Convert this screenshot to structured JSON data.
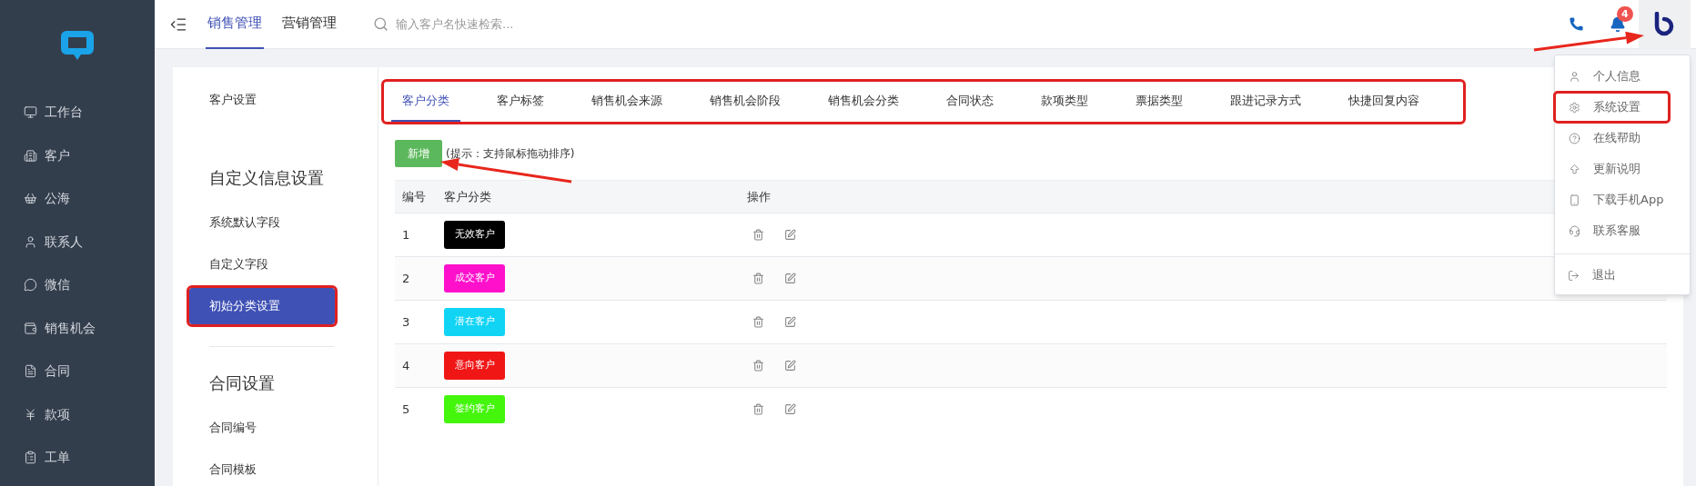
{
  "sidebar": {
    "items": [
      {
        "label": "工作台"
      },
      {
        "label": "客户"
      },
      {
        "label": "公海"
      },
      {
        "label": "联系人"
      },
      {
        "label": "微信"
      },
      {
        "label": "销售机会"
      },
      {
        "label": "合同"
      },
      {
        "label": "款项"
      },
      {
        "label": "工单"
      }
    ]
  },
  "top_nav": {
    "tabs": [
      {
        "label": "销售管理",
        "selected": true
      },
      {
        "label": "营销管理",
        "selected": false
      }
    ],
    "search": {
      "placeholder": "输入客户名快速检索..."
    },
    "notifications": {
      "badge": "4"
    }
  },
  "settings_nav": {
    "groups": [
      {
        "items": [
          {
            "label": "客户设置",
            "selected": false,
            "highlighted": false
          }
        ]
      },
      {
        "divider_above": false,
        "heading": "自定义信息设置",
        "items": [
          {
            "label": "系统默认字段",
            "selected": false,
            "highlighted": false
          },
          {
            "label": "自定义字段",
            "selected": false,
            "highlighted": false
          },
          {
            "label": "初始分类设置",
            "selected": true,
            "highlighted": true
          }
        ]
      },
      {
        "divider_above": true,
        "heading": "合同设置",
        "items": [
          {
            "label": "合同编号",
            "selected": false,
            "highlighted": false
          },
          {
            "label": "合同模板",
            "selected": false,
            "highlighted": false
          }
        ]
      }
    ]
  },
  "tabs": {
    "highlighted": true,
    "items": [
      {
        "label": "客户分类",
        "selected": true
      },
      {
        "label": "客户标签",
        "selected": false
      },
      {
        "label": "销售机会来源",
        "selected": false
      },
      {
        "label": "销售机会阶段",
        "selected": false
      },
      {
        "label": "销售机会分类",
        "selected": false
      },
      {
        "label": "合同状态",
        "selected": false
      },
      {
        "label": "款项类型",
        "selected": false
      },
      {
        "label": "票据类型",
        "selected": false
      },
      {
        "label": "跟进记录方式",
        "selected": false
      },
      {
        "label": "快捷回复内容",
        "selected": false
      }
    ]
  },
  "toolbar": {
    "add_button": "新增",
    "hint": "(提示：支持鼠标拖动排序)"
  },
  "table": {
    "columns": [
      "编号",
      "客户分类",
      "操作"
    ],
    "rows": [
      {
        "number": "1",
        "category": "无效客户",
        "color": "#000000"
      },
      {
        "number": "2",
        "category": "成交客户",
        "color": "#ff11cc"
      },
      {
        "number": "3",
        "category": "潜在客户",
        "color": "#11d4f5"
      },
      {
        "number": "4",
        "category": "意向客户",
        "color": "#f01616"
      },
      {
        "number": "5",
        "category": "签约客户",
        "color": "#44f50c"
      }
    ]
  },
  "user_menu": {
    "items": [
      {
        "label": "个人信息",
        "highlighted": false
      },
      {
        "label": "系统设置",
        "highlighted": true
      },
      {
        "label": "在线帮助",
        "highlighted": false
      },
      {
        "label": "更新说明",
        "highlighted": false
      },
      {
        "label": "下载手机App",
        "highlighted": false
      },
      {
        "label": "联系客服",
        "highlighted": false
      }
    ],
    "logout": {
      "label": "退出"
    }
  }
}
